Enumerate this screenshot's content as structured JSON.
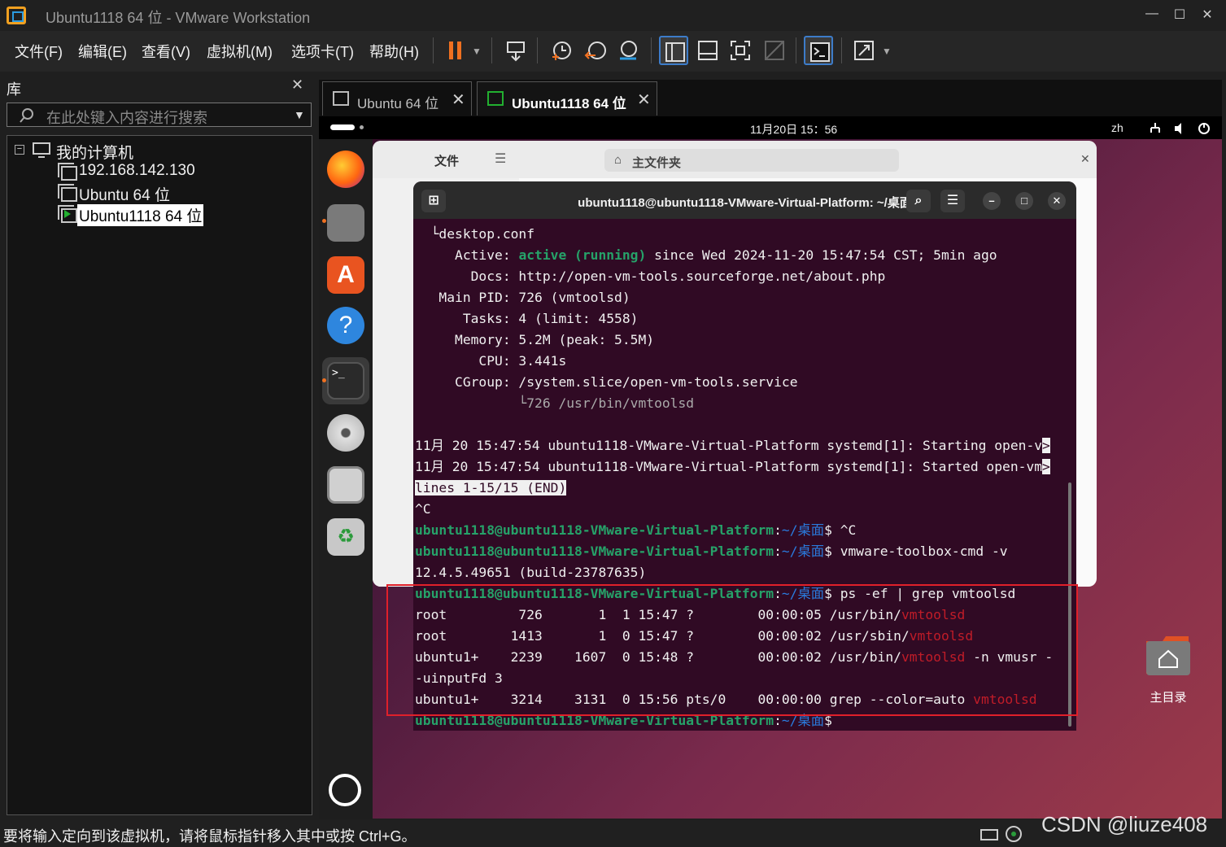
{
  "window": {
    "title": "Ubuntu1118 64 位 - VMware Workstation",
    "controls": [
      "—",
      "☐",
      "✕"
    ]
  },
  "menubar": {
    "items": [
      "文件(F)",
      "编辑(E)",
      "查看(V)",
      "虚拟机(M)",
      "选项卡(T)",
      "帮助(H)"
    ]
  },
  "library": {
    "title": "库",
    "close": "✕",
    "search_placeholder": "在此处键入内容进行搜索",
    "tree": {
      "root": "我的计算机",
      "items": [
        "192.168.142.130",
        "Ubuntu 64 位",
        "Ubuntu1118 64 位"
      ]
    }
  },
  "tabs": [
    {
      "label": "Ubuntu 64 位",
      "close": "✕"
    },
    {
      "label": "Ubuntu1118 64 位",
      "close": "✕"
    }
  ],
  "guest": {
    "clock": "11月20日  15：56",
    "lang": "zh",
    "files": {
      "header_left": "文件",
      "header_path": "主文件夹"
    },
    "home_label": "主目录"
  },
  "terminal": {
    "title": "ubuntu1118@ubuntu1118-VMware-Virtual-Platform: ~/桌面",
    "prompt_user": "ubuntu1118@ubuntu1118-VMware-Virtual-Platform",
    "prompt_path": "~/桌面",
    "lines": {
      "l1": "  └desktop.conf",
      "l2_a": "     Active: ",
      "l2_b": "active (running)",
      "l2_c": " since Wed 2024-11-20 15:47:54 CST; 5min ago",
      "l3": "       Docs: http://open-vm-tools.sourceforge.net/about.php",
      "l4": "   Main PID: 726 (vmtoolsd)",
      "l5": "      Tasks: 4 (limit: 4558)",
      "l6": "     Memory: 5.2M (peak: 5.5M)",
      "l7": "        CPU: 3.441s",
      "l8": "     CGroup: /system.slice/open-vm-tools.service",
      "l9": "             └726 /usr/bin/vmtoolsd",
      "l10": "11月 20 15:47:54 ubuntu1118-VMware-Virtual-Platform systemd[1]: Starting open-v",
      "l11": "11月 20 15:47:54 ubuntu1118-VMware-Virtual-Platform systemd[1]: Started open-vm",
      "l12": "lines 1-15/15 (END)",
      "l13": "^C",
      "cmd1": "$ ^C",
      "cmd2": "$ vmware-toolbox-cmd -v",
      "l16": "12.4.5.49651 (build-23787635)",
      "cmd3": "$ ps -ef | grep vmtoolsd",
      "p1_a": "root         726       1  1 15:47 ?        00:00:05 /usr/bin/",
      "p2_a": "root        1413       1  0 15:47 ?        00:00:02 /usr/sbin/",
      "p3_a": "ubuntu1+    2239    1607  0 15:48 ?        00:00:02 /usr/bin/",
      "p3_b": " -n vmusr -",
      "p3c": "-uinputFd 3",
      "p4_a": "ubuntu1+    3214    3131  0 15:56 pts/0    00:00:00 grep --color=auto ",
      "match": "vmtoolsd",
      "cmd4": "$"
    }
  },
  "statusbar": {
    "message": "要将输入定向到该虚拟机，请将鼠标指针移入其中或按 Ctrl+G。",
    "watermark": "CSDN @liuze408"
  }
}
